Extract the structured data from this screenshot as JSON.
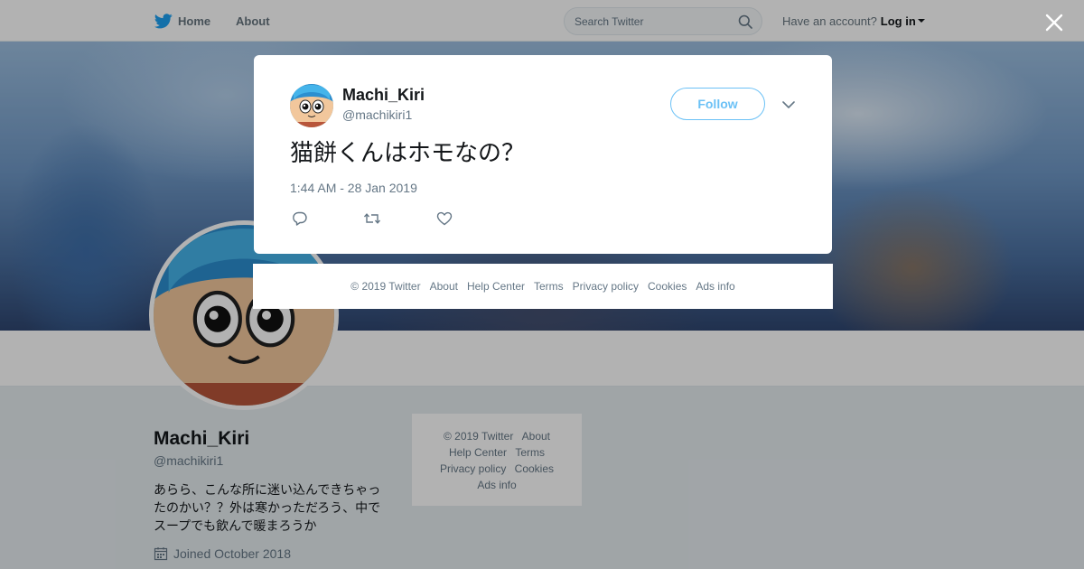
{
  "topbar": {
    "home_label": "Home",
    "about_label": "About",
    "search_placeholder": "Search Twitter",
    "account_prompt": "Have an account?",
    "login_label": "Log in"
  },
  "profile": {
    "name": "Machi_Kiri",
    "handle": "@machikiri1",
    "bio": "あらら、こんな所に迷い込んできちゃったのかい？？外は寒かっただろう、中でスープでも飲んで暖まろうか",
    "joined": "Joined October 2018"
  },
  "side_footer": {
    "copyright": "© 2019 Twitter",
    "about": "About",
    "help": "Help Center",
    "terms": "Terms",
    "privacy": "Privacy policy",
    "cookies": "Cookies",
    "ads": "Ads info"
  },
  "tweet": {
    "author_name": "Machi_Kiri",
    "author_handle": "@machikiri1",
    "follow_label": "Follow",
    "text": "猫餅くんはホモなの？",
    "timestamp": "1:44 AM - 28 Jan 2019"
  },
  "modal_footer": {
    "copyright": "© 2019 Twitter",
    "about": "About",
    "help": "Help Center",
    "terms": "Terms",
    "privacy": "Privacy policy",
    "cookies": "Cookies",
    "ads": "Ads info"
  },
  "icons": {
    "brand": "twitter-bird-icon",
    "search": "search-icon",
    "close": "close-icon",
    "caret": "caret-down-icon",
    "chevron": "chevron-down-icon",
    "reply": "reply-icon",
    "retweet": "retweet-icon",
    "like": "heart-icon",
    "calendar": "calendar-icon"
  },
  "colors": {
    "brand_blue": "#1da1f2",
    "text_secondary": "#657786",
    "overlay": "rgba(0,0,0,0.3)"
  }
}
